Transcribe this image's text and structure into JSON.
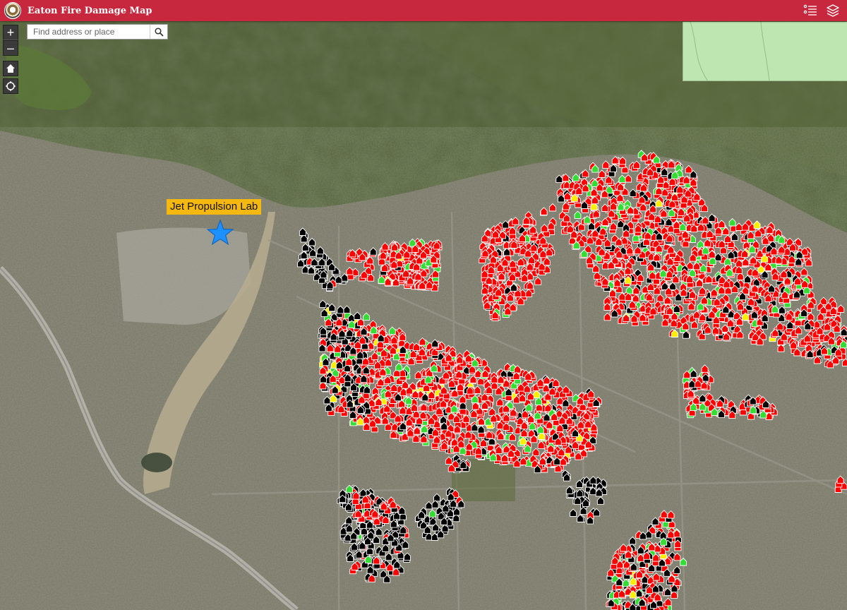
{
  "app": {
    "title": "Eaton Fire Damage Map"
  },
  "header": {
    "legend_icon": "legend-list-icon",
    "layers_icon": "layers-icon"
  },
  "controls": {
    "zoom_in_label": "+",
    "zoom_out_label": "–",
    "home_icon": "home-icon",
    "locate_icon": "locate-icon"
  },
  "search": {
    "placeholder": "Find address or place",
    "value": "",
    "icon": "search-icon"
  },
  "map": {
    "basemap": "satellite imagery",
    "landmark_label": "Jet Propulsion Lab",
    "landmark_icon": "star-marker-icon",
    "overview_inset": "overview-map"
  },
  "damage_categories": [
    {
      "key": "destroyed",
      "color": "#ff0000"
    },
    {
      "key": "damaged",
      "color": "#000000"
    },
    {
      "key": "minor",
      "color": "#33dd33"
    },
    {
      "key": "affected",
      "color": "#ffee00"
    }
  ],
  "colors": {
    "header": "#c8283d",
    "label_bg": "#f5b80f",
    "star": "#1e90ff",
    "overview": "#bde6b0"
  }
}
